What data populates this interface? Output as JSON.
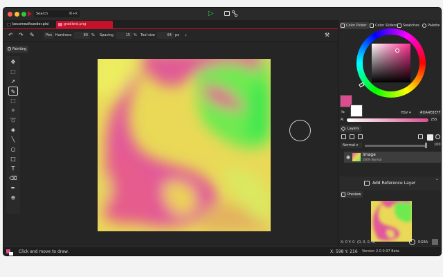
{
  "titlebar": {
    "search_label": "Search",
    "search_shortcut": "⌘+K"
  },
  "tabs": [
    {
      "label": "becomeafounder.pixi",
      "active": false
    },
    {
      "label": "gradient.png",
      "active": true
    }
  ],
  "tool_options": {
    "tool_name": "Pen",
    "hardness_label": "Hardness",
    "hardness_value": "80",
    "hardness_unit": "%",
    "spacing_label": "Spacing",
    "spacing_value": "15",
    "spacing_unit": "%",
    "toolsize_label": "Tool size",
    "toolsize_value": "64",
    "toolsize_unit": "px",
    "collapse_glyph": "‹"
  },
  "painting_tab": "Painting",
  "tools": [
    "move",
    "transform",
    "select",
    "pen",
    "marquee",
    "wand",
    "lasso",
    "fill",
    "line",
    "ellipse",
    "rectangle",
    "text",
    "eraser",
    "eyedropper",
    "zoom"
  ],
  "status": {
    "hint": "Click and move to draw.",
    "coords": "X: 598 Y: 216"
  },
  "right_panel": {
    "tabs": [
      "Color Picker",
      "Color Sliders",
      "Swatches",
      "Palette"
    ],
    "color_mode": "HSV",
    "hex_value": "#DA4E8EFF",
    "alpha_label": "A:",
    "alpha_value": "255",
    "primary_color": "#DA4E8E",
    "secondary_color": "#FFFFFF",
    "layers_title": "Layers",
    "blend_mode": "Normal",
    "opacity_value": "100",
    "layer_name": "Image",
    "layer_sub": "100% Normal",
    "add_reference": "Add Reference Layer",
    "preview_title": "Preview",
    "preview_coords": "X: 0 Y: 0",
    "preview_rgb": "(0, 0, 0, 0)",
    "preview_mode": "RGBA",
    "version": "Version 2.0.0.97 Beta"
  },
  "colors": {
    "accent": "#C4122B",
    "play": "#3FC24A",
    "panel_bg": "#262626"
  }
}
